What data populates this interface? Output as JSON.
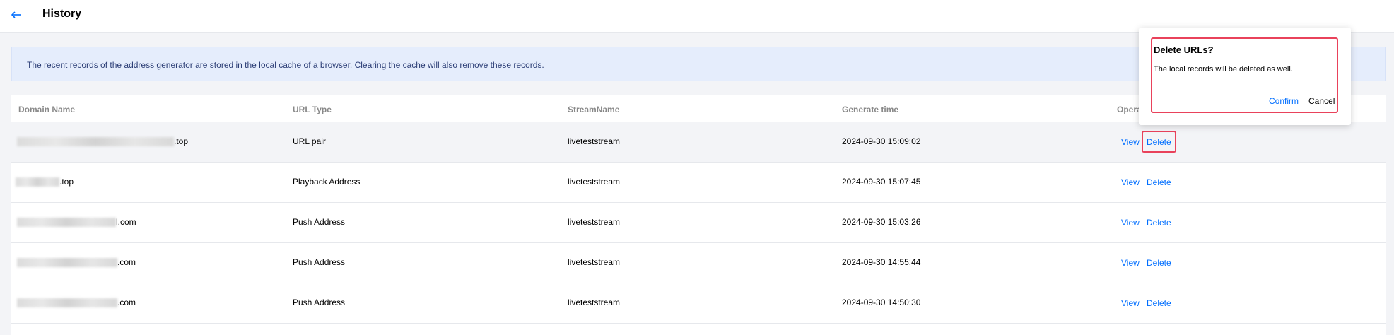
{
  "header": {
    "title": "History",
    "back_icon": "arrow-left-icon",
    "accent_color": "#006eff"
  },
  "notice": {
    "text": "The recent records of the address generator are stored in the local cache of a browser. Clearing the cache will also remove these records."
  },
  "table": {
    "columns": [
      "Domain Name",
      "URL Type",
      "StreamName",
      "Generate time",
      "Opera"
    ],
    "rows": [
      {
        "domain_suffix": ".top",
        "url_type": "URL pair",
        "stream": "liveteststream",
        "time": "2024-09-30 15:09:02",
        "view": "View",
        "delete": "Delete"
      },
      {
        "domain_suffix": ".top",
        "url_type": "Playback Address",
        "stream": "liveteststream",
        "time": "2024-09-30 15:07:45",
        "view": "View",
        "delete": "Delete"
      },
      {
        "domain_suffix": "l.com",
        "url_type": "Push Address",
        "stream": "liveteststream",
        "time": "2024-09-30 15:03:26",
        "view": "View",
        "delete": "Delete"
      },
      {
        "domain_suffix": ".com",
        "url_type": "Push Address",
        "stream": "liveteststream",
        "time": "2024-09-30 14:55:44",
        "view": "View",
        "delete": "Delete"
      },
      {
        "domain_suffix": ".com",
        "url_type": "Push Address",
        "stream": "liveteststream",
        "time": "2024-09-30 14:50:30",
        "view": "View",
        "delete": "Delete"
      }
    ]
  },
  "popover": {
    "title": "Delete URLs?",
    "message": "The local records will be deleted as well.",
    "confirm_label": "Confirm",
    "cancel_label": "Cancel",
    "highlight_color": "#e9425b"
  }
}
